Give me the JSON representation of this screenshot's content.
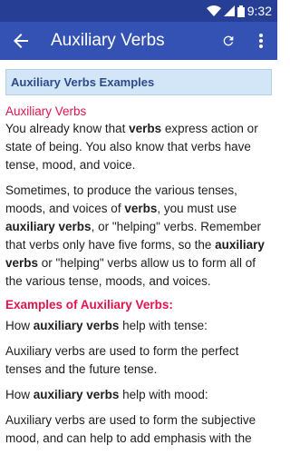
{
  "status": {
    "time": "9:32"
  },
  "toolbar": {
    "title": "Auxiliary Verbs"
  },
  "content": {
    "section_header": "Auxiliary Verbs Examples",
    "subtitle1": "Auxiliary Verbs",
    "p1": {
      "a": "You already know that ",
      "b": "verbs",
      "c": " express action or state of being. You also know that verbs have tense, mood, and voice."
    },
    "p2": {
      "a": "Sometimes, to produce the various tenses, moods, and voices of ",
      "b": "verbs",
      "c": ", you must use ",
      "d": "auxiliary verbs",
      "e": ", or \"helping\" verbs. Remember that verbs only have five forms, so the ",
      "f": "auxiliary verbs",
      "g": " or \"helping\" verbs allow us to form all of the various tense, moods, and voices."
    },
    "subtitle2": "Examples of Auxiliary Verbs:",
    "p3": {
      "a": "How ",
      "b": "auxiliary verbs",
      "c": " help with tense:"
    },
    "p4": "Auxiliary verbs are used to form the perfect tenses and the future tense.",
    "p5": {
      "a": "How ",
      "b": "auxiliary verbs",
      "c": " help with mood:"
    },
    "p6": "Auxiliary verbs are used to form the subjective mood, and can help to add emphasis with the"
  }
}
